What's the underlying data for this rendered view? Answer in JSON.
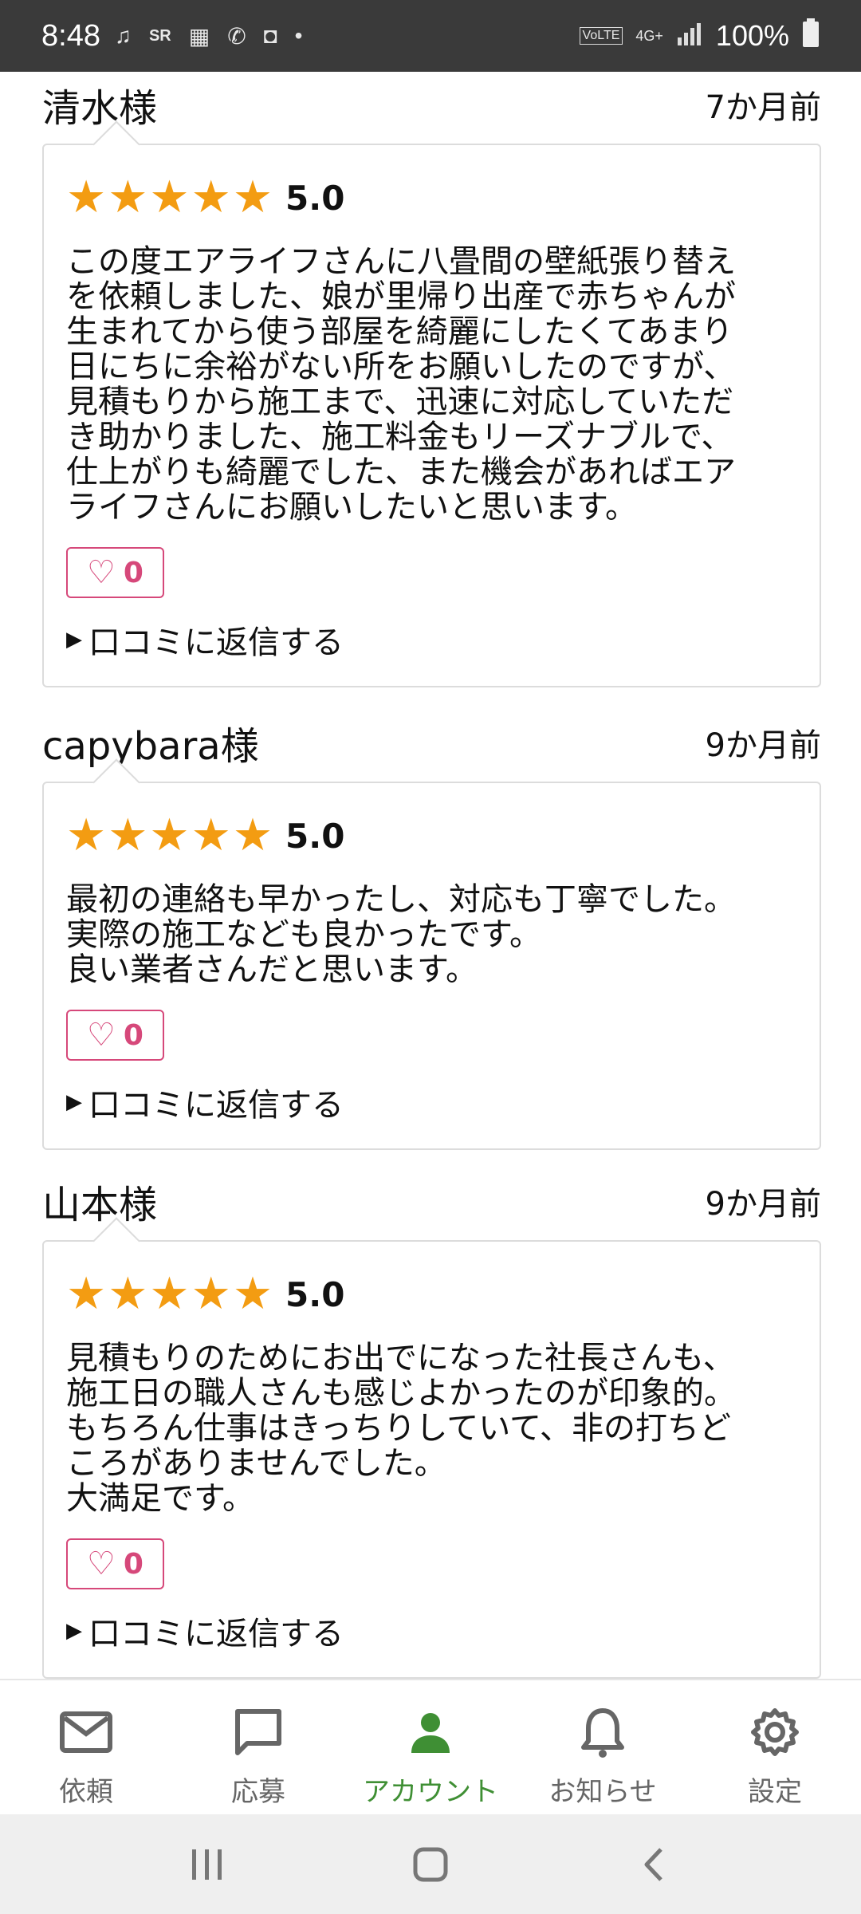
{
  "status_bar": {
    "time": "8:48",
    "battery": "100%",
    "network": "4G+",
    "volte": "VoLTE"
  },
  "reviews": [
    {
      "name": "清水様",
      "date": "7か月前",
      "rating": "5.0",
      "text": "この度エアライフさんに八畳間の壁紙張り替え\nを依頼しました、娘が里帰り出産で赤ちゃんが\n生まれてから使う部屋を綺麗にしたくてあまり\n日にちに余裕がない所をお願いしたのですが、\n見積もりから施工まで、迅速に対応していただ\nき助かりました、施工料金もリーズナブルで、\n仕上がりも綺麗でした、また機会があればエア\nライフさんにお願いしたいと思います。",
      "likes": "0",
      "reply": "口コミに返信する"
    },
    {
      "name": "capybara様",
      "date": "9か月前",
      "rating": "5.0",
      "text": "最初の連絡も早かったし、対応も丁寧でした。\n実際の施工なども良かったです。\n良い業者さんだと思います。",
      "likes": "0",
      "reply": "口コミに返信する"
    },
    {
      "name": "山本様",
      "date": "9か月前",
      "rating": "5.0",
      "text": "見積もりのためにお出でになった社長さんも、\n施工日の職人さんも感じよかったのが印象的。\nもちろん仕事はきっちりしていて、非の打ちど\nころがありませんでした。\n大満足です。",
      "likes": "0",
      "reply": "口コミに返信する"
    }
  ],
  "bottom_nav": {
    "items": [
      {
        "label": "依頼",
        "icon": "mail-icon"
      },
      {
        "label": "応募",
        "icon": "chat-icon"
      },
      {
        "label": "アカウント",
        "icon": "person-icon"
      },
      {
        "label": "お知らせ",
        "icon": "bell-icon"
      },
      {
        "label": "設定",
        "icon": "gear-icon"
      }
    ],
    "active_index": 2
  },
  "colors": {
    "star": "#f39c12",
    "like": "#d6487a",
    "active_nav": "#3f8f34"
  }
}
